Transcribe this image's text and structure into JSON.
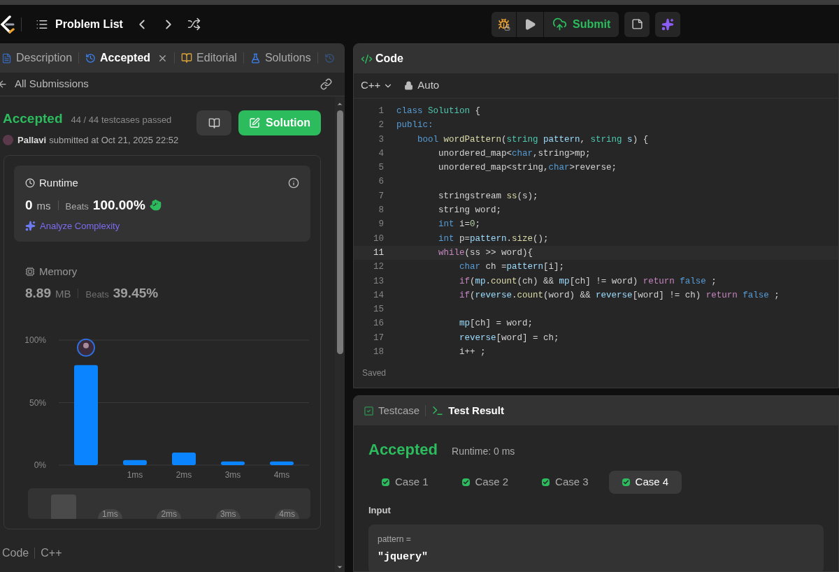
{
  "header": {
    "title": "Problem List"
  },
  "toolbar": {
    "submit": "Submit"
  },
  "left_tabs": [
    {
      "label": "Description",
      "kind": "description",
      "selected": false,
      "closable": false
    },
    {
      "label": "Accepted",
      "kind": "history",
      "selected": true,
      "closable": true
    },
    {
      "label": "Editorial",
      "kind": "book",
      "selected": false,
      "closable": false
    },
    {
      "label": "Solutions",
      "kind": "flask",
      "selected": false,
      "closable": false
    }
  ],
  "back_link": "All Submissions",
  "submission": {
    "status": "Accepted",
    "testcases": "44 / 44 testcases passed",
    "user": "Pallavi",
    "submitted": "submitted at Oct 21, 2025 22:52",
    "solution_button": "Solution"
  },
  "metrics": [
    {
      "kind": "runtime",
      "title": "Runtime",
      "value": "0",
      "unit": "ms",
      "beats_label": "Beats",
      "beats": "100.00%",
      "selected": true,
      "analyze": "Analyze Complexity"
    },
    {
      "kind": "memory",
      "title": "Memory",
      "value": "8.89",
      "unit": "MB",
      "beats_label": "Beats",
      "beats": "39.45%",
      "selected": false
    }
  ],
  "chart_data": {
    "type": "bar",
    "categories": [
      null,
      "1ms",
      "2ms",
      "3ms",
      "4ms"
    ],
    "values": [
      80,
      4,
      10,
      3,
      3
    ],
    "ylim": [
      0,
      100
    ],
    "yticks": [
      {
        "value": 0,
        "label": "0%"
      },
      {
        "value": 50,
        "label": "50%"
      },
      {
        "value": 100,
        "label": "100%"
      }
    ]
  },
  "overview_labels": [
    "1ms",
    "2ms",
    "3ms",
    "4ms"
  ],
  "code_footer": {
    "label": "Code",
    "language": "C++"
  },
  "editor": {
    "title": "Code",
    "language": "C++",
    "mode": "Auto",
    "status": "Saved",
    "lines": [
      {
        "n": "1",
        "active": false,
        "tokens": [
          {
            "text": "class",
            "kind": "keyword"
          },
          {
            "text": " Solution",
            "kind": "type"
          },
          {
            "text": " {",
            "kind": "plain"
          }
        ]
      },
      {
        "n": "2",
        "active": false,
        "tokens": [
          {
            "text": "public:",
            "kind": "keyword"
          }
        ]
      },
      {
        "n": "3",
        "active": false,
        "tokens": [
          {
            "text": "    bool",
            "kind": "keyword"
          },
          {
            "text": " wordPattern",
            "kind": "function"
          },
          {
            "text": "(",
            "kind": "plain"
          },
          {
            "text": "string",
            "kind": "type"
          },
          {
            "text": " pattern",
            "kind": "variable"
          },
          {
            "text": ",",
            "kind": "plain"
          },
          {
            "text": " string",
            "kind": "type"
          },
          {
            "text": " s",
            "kind": "variable"
          },
          {
            "text": ") {",
            "kind": "plain"
          }
        ]
      },
      {
        "n": "4",
        "active": false,
        "tokens": [
          {
            "text": "        unordered_map<",
            "kind": "plain"
          },
          {
            "text": "char",
            "kind": "keyword"
          },
          {
            "text": ",string>mp;",
            "kind": "plain"
          }
        ]
      },
      {
        "n": "5",
        "active": false,
        "tokens": [
          {
            "text": "        unordered_map<string,",
            "kind": "plain"
          },
          {
            "text": "char",
            "kind": "keyword"
          },
          {
            "text": ">reverse;",
            "kind": "plain"
          }
        ]
      },
      {
        "n": "6",
        "active": false
      },
      {
        "n": "7",
        "active": false,
        "tokens": [
          {
            "text": "        stringstream",
            "kind": "plain"
          },
          {
            "text": " ss",
            "kind": "function"
          },
          {
            "text": "(s);",
            "kind": "plain"
          }
        ]
      },
      {
        "n": "8",
        "active": false,
        "tokens": [
          {
            "text": "        string word;",
            "kind": "plain"
          }
        ]
      },
      {
        "n": "9",
        "active": false,
        "tokens": [
          {
            "text": "        int",
            "kind": "keyword"
          },
          {
            "text": " i=",
            "kind": "plain"
          },
          {
            "text": "0",
            "kind": "number"
          },
          {
            "text": ";",
            "kind": "plain"
          }
        ]
      },
      {
        "n": "10",
        "active": false,
        "tokens": [
          {
            "text": "        int",
            "kind": "keyword"
          },
          {
            "text": " p=",
            "kind": "plain"
          },
          {
            "text": "pattern",
            "kind": "variable"
          },
          {
            "text": ".",
            "kind": "plain"
          },
          {
            "text": "size",
            "kind": "function"
          },
          {
            "text": "();",
            "kind": "plain"
          }
        ]
      },
      {
        "n": "11",
        "active": true,
        "tokens": [
          {
            "text": "        while",
            "kind": "control"
          },
          {
            "text": "(ss >> word){",
            "kind": "plain"
          }
        ]
      },
      {
        "n": "12",
        "active": false,
        "tokens": [
          {
            "text": "            char",
            "kind": "keyword"
          },
          {
            "text": " ch =",
            "kind": "plain"
          },
          {
            "text": "pattern",
            "kind": "variable"
          },
          {
            "text": "[i];",
            "kind": "plain"
          }
        ]
      },
      {
        "n": "13",
        "active": false,
        "tokens": [
          {
            "text": "            if",
            "kind": "control"
          },
          {
            "text": "(",
            "kind": "plain"
          },
          {
            "text": "mp",
            "kind": "variable"
          },
          {
            "text": ".",
            "kind": "plain"
          },
          {
            "text": "count",
            "kind": "function"
          },
          {
            "text": "(ch) &&",
            "kind": "plain"
          },
          {
            "text": " mp",
            "kind": "variable"
          },
          {
            "text": "[ch] != word)",
            "kind": "plain"
          },
          {
            "text": " return",
            "kind": "control"
          },
          {
            "text": " false",
            "kind": "keyword"
          },
          {
            "text": " ;",
            "kind": "plain"
          }
        ]
      },
      {
        "n": "14",
        "active": false,
        "tokens": [
          {
            "text": "            if",
            "kind": "control"
          },
          {
            "text": "(",
            "kind": "plain"
          },
          {
            "text": "reverse",
            "kind": "variable"
          },
          {
            "text": ".",
            "kind": "plain"
          },
          {
            "text": "count",
            "kind": "function"
          },
          {
            "text": "(word) &&",
            "kind": "plain"
          },
          {
            "text": " reverse",
            "kind": "variable"
          },
          {
            "text": "[word] != ch)",
            "kind": "plain"
          },
          {
            "text": " return",
            "kind": "control"
          },
          {
            "text": " false",
            "kind": "keyword"
          },
          {
            "text": " ;",
            "kind": "plain"
          }
        ]
      },
      {
        "n": "15",
        "active": false
      },
      {
        "n": "16",
        "active": false,
        "tokens": [
          {
            "text": "            mp",
            "kind": "variable"
          },
          {
            "text": "[ch] = word;",
            "kind": "plain"
          }
        ]
      },
      {
        "n": "17",
        "active": false,
        "tokens": [
          {
            "text": "            reverse",
            "kind": "variable"
          },
          {
            "text": "[word] = ch;",
            "kind": "plain"
          }
        ]
      },
      {
        "n": "18",
        "active": false,
        "tokens": [
          {
            "text": "            i++ ;",
            "kind": "plain"
          }
        ]
      }
    ]
  },
  "test_panel": {
    "tabs": [
      {
        "label": "Testcase",
        "kind": "testcase",
        "selected": false
      },
      {
        "label": "Test Result",
        "kind": "result",
        "selected": true
      }
    ],
    "status": "Accepted",
    "runtime": "Runtime: 0 ms",
    "cases": [
      {
        "label": "Case 1",
        "passed": true,
        "selected": false
      },
      {
        "label": "Case 2",
        "passed": true,
        "selected": false
      },
      {
        "label": "Case 3",
        "passed": true,
        "selected": false
      },
      {
        "label": "Case 4",
        "passed": true,
        "selected": true
      }
    ],
    "input_label": "Input",
    "param": "pattern =",
    "value": "\"jquery\""
  }
}
